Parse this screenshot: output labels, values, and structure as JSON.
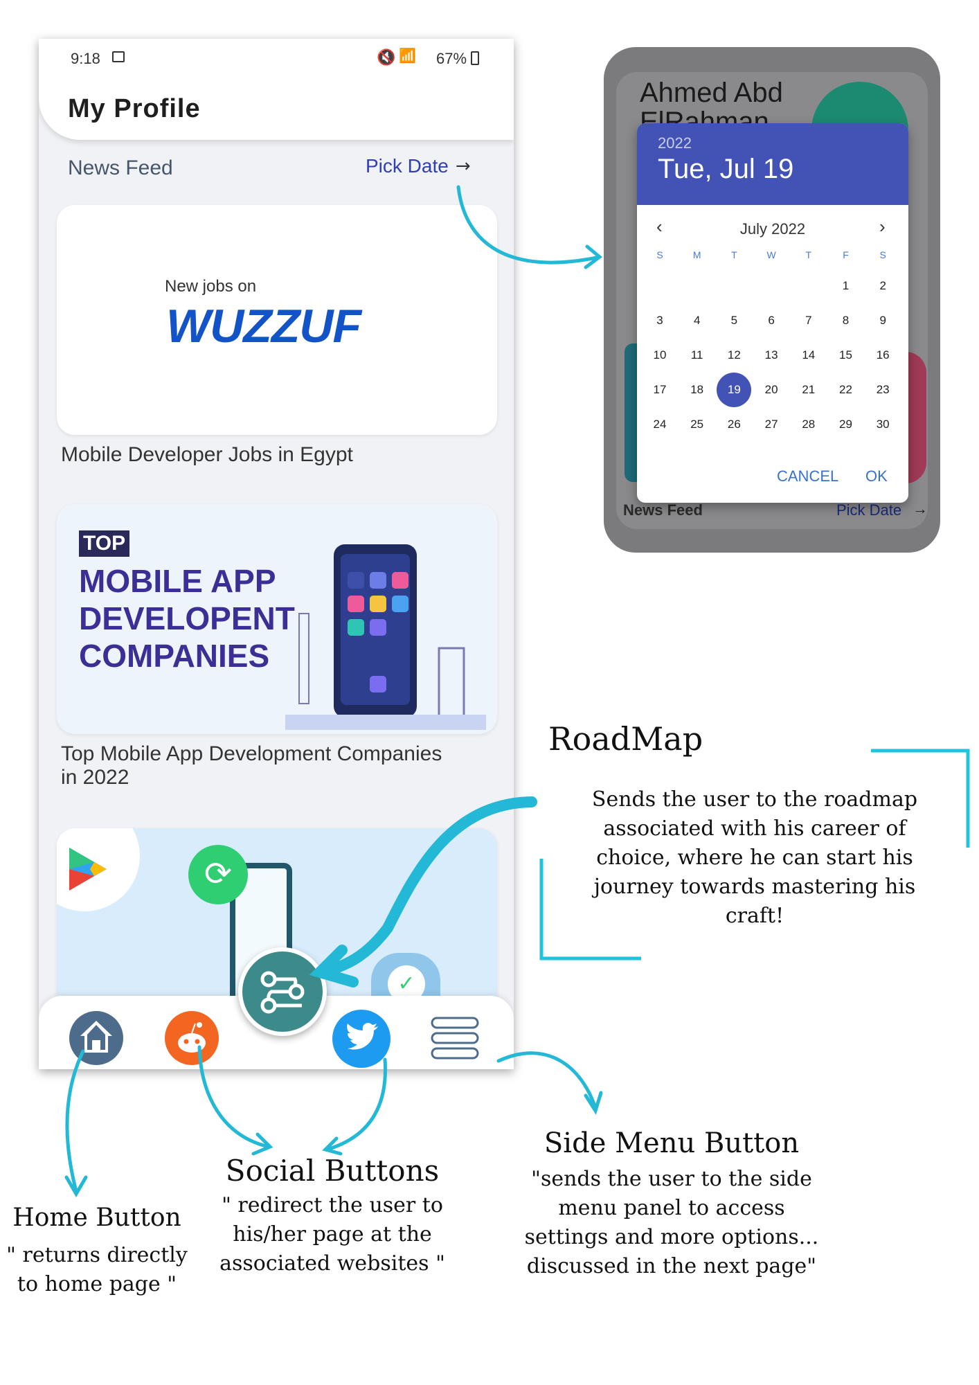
{
  "status_bar": {
    "time": "9:18",
    "battery": "67%"
  },
  "header": {
    "title": "My Profile"
  },
  "feed": {
    "title": "News Feed",
    "pick_date": "Pick Date"
  },
  "cards": [
    {
      "img_small": "New jobs on",
      "img_big": "WUZZUF",
      "caption": "Mobile Developer Jobs in Egypt"
    },
    {
      "img_tag": "TOP",
      "img_lines": [
        "MOBILE APP",
        "DEVELOPENT",
        "COMPANIES"
      ],
      "caption_lines": [
        "Top Mobile App Development Companies",
        "in 2022"
      ]
    }
  ],
  "datepicker": {
    "behind_name_1": "Ahmed Abd",
    "behind_name_2": "ElRahman",
    "behind_feed": "News Feed",
    "behind_pick": "Pick Date",
    "year": "2022",
    "date": "Tue, Jul 19",
    "month": "July 2022",
    "weekdays": [
      "S",
      "M",
      "T",
      "W",
      "T",
      "F",
      "S"
    ],
    "days": [
      "1",
      "2",
      "3",
      "4",
      "5",
      "6",
      "7",
      "8",
      "9",
      "10",
      "11",
      "12",
      "13",
      "14",
      "15",
      "16",
      "17",
      "18",
      "19",
      "20",
      "21",
      "22",
      "23",
      "24",
      "25",
      "26",
      "27",
      "28",
      "29",
      "30"
    ],
    "selected_day": "19",
    "cancel": "CANCEL",
    "ok": "OK"
  },
  "annotations": {
    "roadmap": {
      "title": "RoadMap",
      "lines": [
        "Sends the user to the roadmap",
        "associated with his career of",
        "choice, where he can start his",
        "journey towards mastering his",
        "craft!"
      ]
    },
    "home": {
      "title": "Home Button",
      "lines": [
        "\" returns directly",
        "to home page \""
      ]
    },
    "social": {
      "title": "Social Buttons",
      "lines": [
        "\" redirect the user to",
        "his/her page at the",
        "associated websites \""
      ]
    },
    "side_menu": {
      "title": "Side Menu Button",
      "lines": [
        "\"sends the user to the side",
        "menu panel to access",
        "settings and more options...",
        "discussed in the next page\""
      ]
    }
  },
  "colors": {
    "accent": "#4253b5",
    "arrow": "#22b8d6",
    "feed_title": "#45556a",
    "pick_date": "#2f3fb0"
  }
}
